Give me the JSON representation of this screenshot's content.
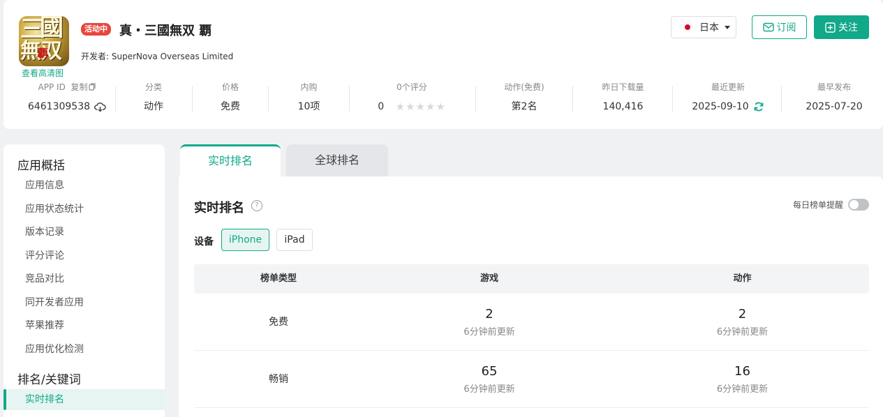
{
  "app": {
    "status_badge": "活动中",
    "title": "真・三國無双 覇",
    "developer": "开发者: SuperNova Overseas Limited",
    "hd_link": "查看高清图",
    "icon_text": [
      "三",
      "國",
      "無双",
      "覇"
    ]
  },
  "header_actions": {
    "region": "日本",
    "subscribe": "订阅",
    "follow": "关注"
  },
  "stats": {
    "app_id_label": "APP ID",
    "copy_label": "复制",
    "app_id": "6461309538",
    "category_label": "分类",
    "category": "动作",
    "price_label": "价格",
    "price": "免费",
    "iap_label": "内购",
    "iap": "10项",
    "rating_label": "0个评分",
    "rating": "0",
    "rank_label": "动作(免费)",
    "rank": "第2名",
    "downloads_label": "昨日下载量",
    "downloads": "140,416",
    "updated_label": "最近更新",
    "updated": "2025-09-10",
    "released_label": "最早发布",
    "released": "2025-07-20"
  },
  "sidebar": {
    "section1": "应用概括",
    "items1": [
      "应用信息",
      "应用状态统计",
      "版本记录",
      "评分评论",
      "竞品对比",
      "同开发者应用",
      "苹果推荐",
      "应用优化检测"
    ],
    "section2": "排名/关键词",
    "items2": [
      "实时排名"
    ]
  },
  "tabs": [
    "实时排名",
    "全球排名"
  ],
  "panel": {
    "title": "实时排名",
    "reminder": "每日榜单提醒",
    "device_label": "设备",
    "devices": [
      "iPhone",
      "iPad"
    ]
  },
  "table": {
    "headers": [
      "榜单类型",
      "游戏",
      "动作"
    ],
    "rows": [
      {
        "type": "免费",
        "game": "2",
        "game_sub": "6分钟前更新",
        "action": "2",
        "action_sub": "6分钟前更新"
      },
      {
        "type": "畅销",
        "game": "65",
        "game_sub": "6分钟前更新",
        "action": "16",
        "action_sub": "6分钟前更新"
      }
    ]
  },
  "colors": {
    "accent": "#12a88a",
    "badge": "#e8463c"
  }
}
